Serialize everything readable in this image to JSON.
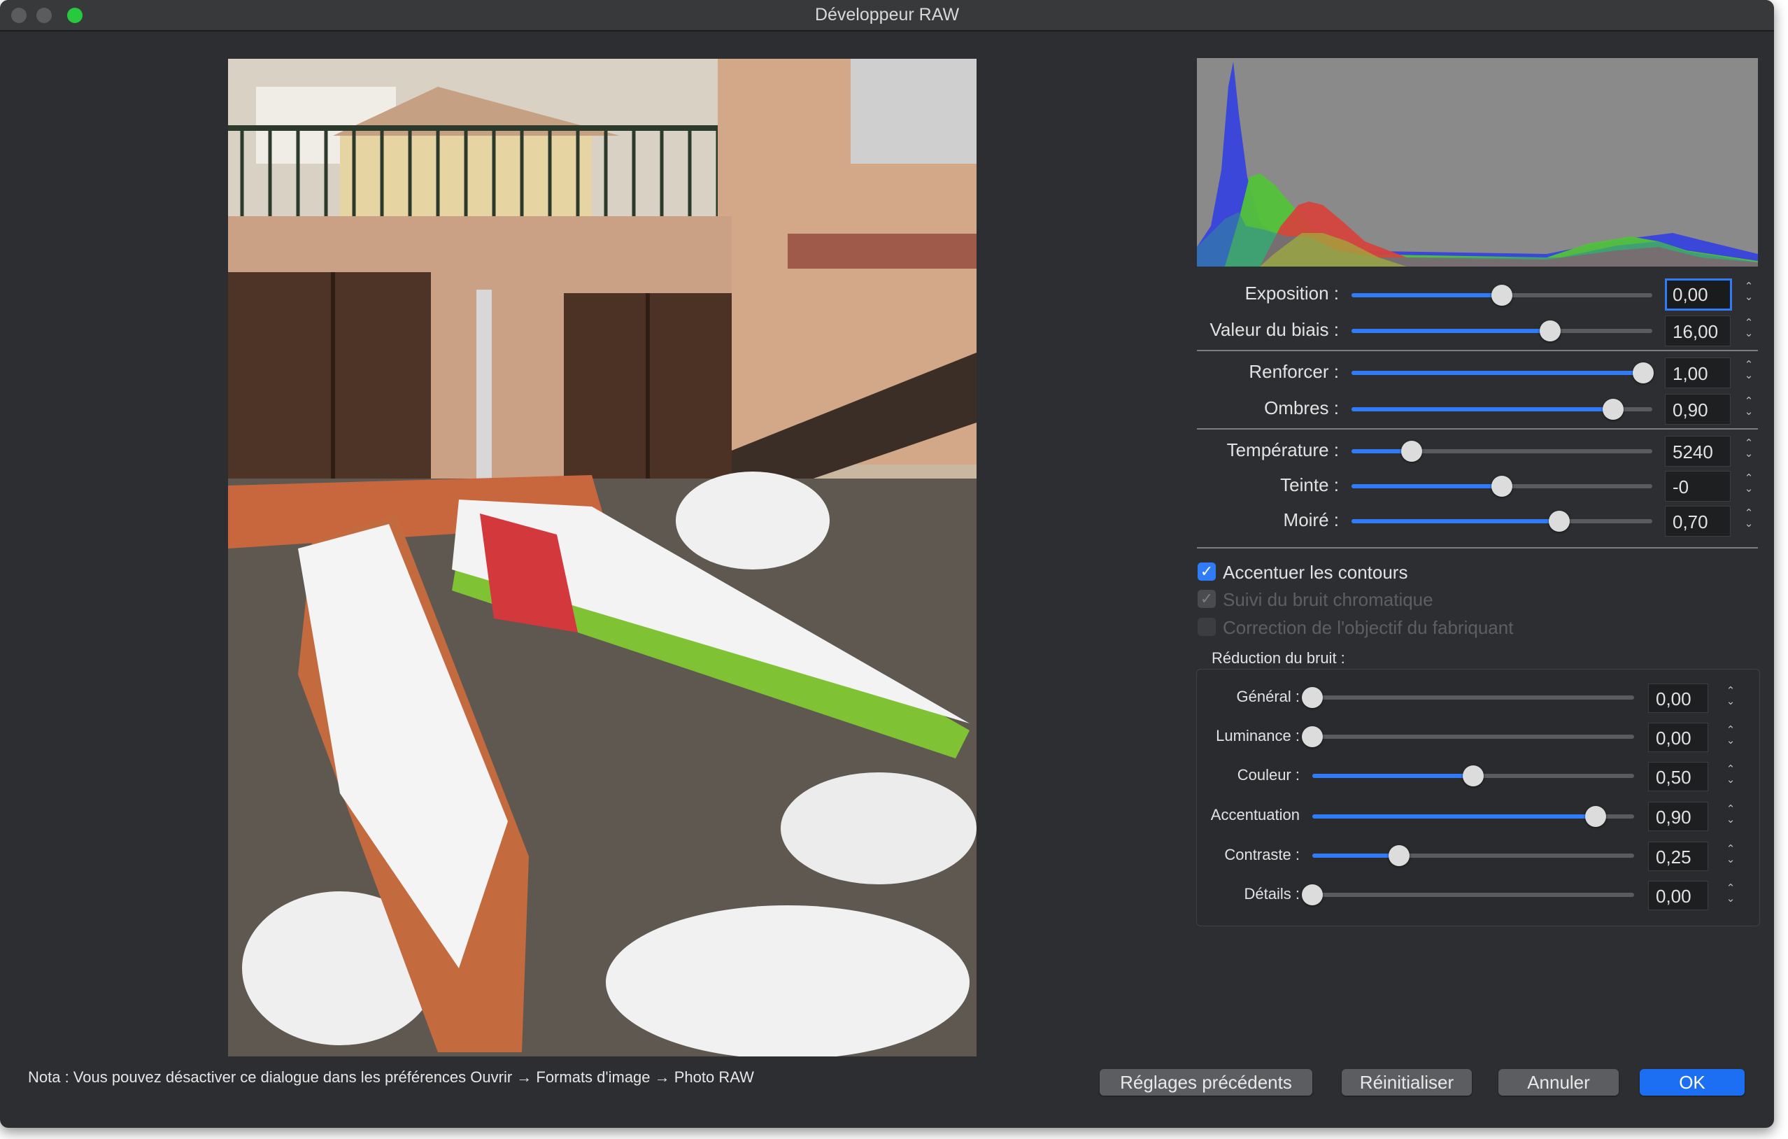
{
  "window": {
    "title": "Développeur RAW",
    "traffic_lights": [
      "close",
      "minimize",
      "zoom"
    ]
  },
  "histogram": {
    "channels": [
      "blue",
      "green",
      "red"
    ]
  },
  "sliders": [
    {
      "label": "Exposition :",
      "value": "0,00",
      "fraction": 0.5
    },
    {
      "label": "Valeur du biais :",
      "value": "16,00",
      "fraction": 0.66
    },
    {
      "label": "Renforcer :",
      "value": "1,00",
      "fraction": 0.97
    },
    {
      "label": "Ombres :",
      "value": "0,90",
      "fraction": 0.87
    },
    {
      "label": "Température :",
      "value": "5240",
      "fraction": 0.2
    },
    {
      "label": "Teinte :",
      "value": "-0",
      "fraction": 0.5
    },
    {
      "label": "Moiré :",
      "value": "0,70",
      "fraction": 0.69
    }
  ],
  "checkboxes": [
    {
      "label": "Accentuer les contours",
      "checked": true,
      "enabled": true
    },
    {
      "label": "Suivi du bruit chromatique",
      "checked": true,
      "enabled": false
    },
    {
      "label": "Correction de l'objectif du fabriquant",
      "checked": false,
      "enabled": false
    }
  ],
  "noise_reduction": {
    "title": "Réduction du bruit :",
    "sliders": [
      {
        "label": "Général :",
        "value": "0,00",
        "fraction": 0.0
      },
      {
        "label": "Luminance :",
        "value": "0,00",
        "fraction": 0.0
      },
      {
        "label": "Couleur :",
        "value": "0,50",
        "fraction": 0.5
      },
      {
        "label": "Accentuation",
        "value": "0,90",
        "fraction": 0.88
      },
      {
        "label": "Contraste :",
        "value": "0,25",
        "fraction": 0.27
      },
      {
        "label": "Détails :",
        "value": "0,00",
        "fraction": 0.0
      }
    ]
  },
  "note": "Nota : Vous pouvez désactiver ce dialogue dans les préférences Ouvrir → Formats d'image → Photo RAW",
  "buttons": {
    "previous": "Réglages précédents",
    "reset": "Réinitialiser",
    "cancel": "Annuler",
    "ok": "OK"
  },
  "colors": {
    "accent": "#2f7cf6",
    "window_bg": "#2d2e31",
    "histogram_bg": "#8a8a8a"
  }
}
